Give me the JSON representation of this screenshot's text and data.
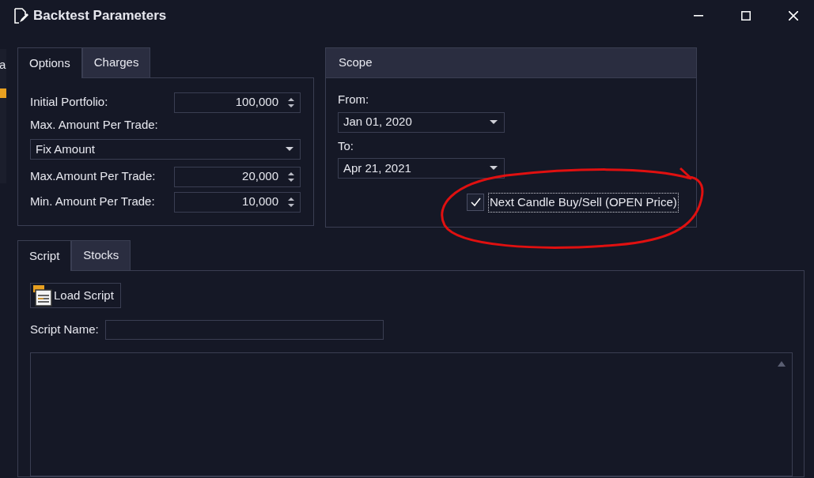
{
  "window": {
    "title": "Backtest Parameters"
  },
  "background_app": {
    "text_fragment": "a"
  },
  "options_tabs": [
    {
      "label": "Options",
      "selected": true
    },
    {
      "label": "Charges",
      "selected": false
    }
  ],
  "options_rows": [
    {
      "kind": "spin",
      "label": "Initial Portfolio:",
      "value": "100,000"
    },
    {
      "kind": "label",
      "label": "Max. Amount Per Trade:"
    },
    {
      "kind": "dropdown",
      "value": "Fix Amount"
    },
    {
      "kind": "spin",
      "label": "Max.Amount Per Trade:",
      "value": "20,000"
    },
    {
      "kind": "spin",
      "label": "Min. Amount Per Trade:",
      "value": "10,000"
    }
  ],
  "scope": {
    "title": "Scope",
    "from": {
      "label": "From:",
      "value": "Jan 01, 2020"
    },
    "to": {
      "label": "To:",
      "value": "Apr 21, 2021"
    },
    "next_candle": {
      "label": "Next Candle Buy/Sell (OPEN Price)",
      "checked": true
    }
  },
  "script_tabs": [
    {
      "label": "Script",
      "selected": true
    },
    {
      "label": "Stocks",
      "selected": false
    }
  ],
  "script": {
    "load_button": "Load Script",
    "name_label": "Script Name:"
  }
}
